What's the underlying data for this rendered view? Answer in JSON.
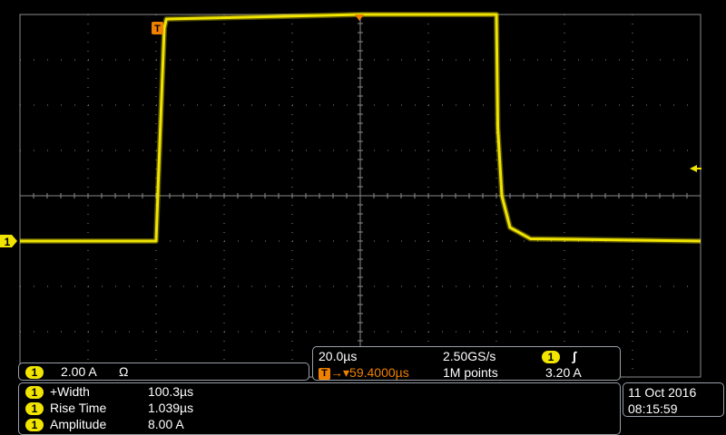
{
  "chart_data": {
    "type": "line",
    "title": "",
    "xlabel": "",
    "ylabel": "",
    "x_divisions": 10,
    "y_divisions": 8,
    "time_per_div_us": 20.0,
    "amps_per_div": 2.0,
    "xlim_div": [
      -5,
      5
    ],
    "ylim_div": [
      -4,
      4
    ],
    "grid": true,
    "series": [
      {
        "color": "#f0e400",
        "x_div": [
          -5.0,
          -3.0,
          -2.97,
          -2.88,
          -2.85,
          0.0,
          2.0,
          2.02,
          2.08,
          2.2,
          2.5,
          5.0
        ],
        "y_div": [
          -1.0,
          -1.0,
          0.2,
          3.7,
          3.9,
          4.0,
          4.0,
          1.5,
          0.0,
          -0.7,
          -0.95,
          -1.0
        ]
      }
    ]
  },
  "trigger_marker": {
    "label": "T"
  },
  "channel_marker": {
    "label": "1"
  },
  "channel_panel": {
    "badge": "1",
    "scale": "2.00 A",
    "coupling": "Ω"
  },
  "horizontal_panel": {
    "time_div": "20.0µs",
    "sample_rate": "2.50GS/s",
    "trig_badge": "1",
    "trig_slope": "∫",
    "trig_icon": "T",
    "arrow": "→▾",
    "position": "59.4000µs",
    "record_length": "1M points",
    "trig_level": "3.20 A"
  },
  "measurements": [
    {
      "badge": "1",
      "label": "+Width",
      "value": "100.3µs"
    },
    {
      "badge": "1",
      "label": "Rise Time",
      "value": "1.039µs"
    },
    {
      "badge": "1",
      "label": "Amplitude",
      "value": "8.00 A"
    }
  ],
  "datetime": {
    "date": "11 Oct  2016",
    "time": "08:15:59"
  },
  "colors": {
    "trace": "#f0e400",
    "trigger": "#f08000",
    "grid": "#8a8a8a",
    "background": "#000000"
  }
}
